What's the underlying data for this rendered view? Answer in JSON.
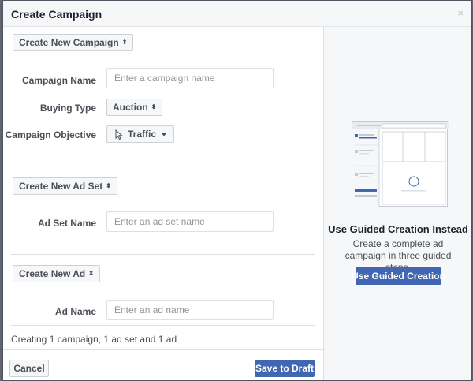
{
  "dialog": {
    "title": "Create Campaign",
    "close_symbol": "×"
  },
  "campaign": {
    "selector_label": "Create New Campaign",
    "name_label": "Campaign Name",
    "name_placeholder": "Enter a campaign name",
    "name_value": "",
    "buying_type_label": "Buying Type",
    "buying_type_value": "Auction",
    "objective_label": "Campaign Objective",
    "objective_value": "Traffic"
  },
  "ad_set": {
    "selector_label": "Create New Ad Set",
    "name_label": "Ad Set Name",
    "name_placeholder": "Enter an ad set name",
    "name_value": ""
  },
  "ad": {
    "selector_label": "Create New Ad",
    "name_label": "Ad Name",
    "name_placeholder": "Enter an ad name",
    "name_value": ""
  },
  "summary": "Creating 1 campaign, 1 ad set and 1 ad",
  "footer": {
    "cancel_label": "Cancel",
    "save_label": "Save to Draft"
  },
  "guided": {
    "title": "Use Guided Creation Instead",
    "description": "Create a complete ad campaign in three guided steps.",
    "button_label": "Use Guided Creation"
  },
  "colors": {
    "primary": "#4267b2",
    "panel_bg": "#f6f7f9",
    "border": "#dddfe2",
    "overlay": "#6b6f77"
  },
  "icons": {
    "close": "close-icon",
    "sort": "updown-icon",
    "objective": "cursor-icon",
    "dropdown": "caret-down-icon"
  }
}
